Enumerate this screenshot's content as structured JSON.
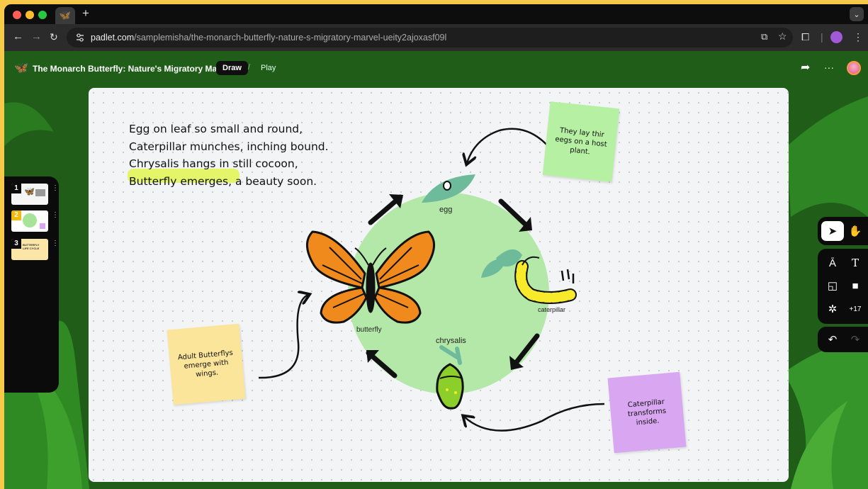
{
  "browser": {
    "url_host": "padlet.com",
    "url_path": "/samplemisha/the-monarch-butterfly-nature-s-migratory-marvel-ueity2ajoxasf09l"
  },
  "app": {
    "title": "The Monarch Butterfly: Nature's Migratory Marvel",
    "mode_draw": "Draw",
    "separator": "/",
    "mode_play": "Play"
  },
  "slides": [
    {
      "num": "1"
    },
    {
      "num": "2"
    },
    {
      "num": "3",
      "thumb_text": "BUTTERFLY LIFE CYCLE"
    }
  ],
  "tools": {
    "more_count": "+17"
  },
  "poem": {
    "line1": "Egg on leaf so small and round,",
    "line2": "Caterpillar munches, inching bound.",
    "line3": "Chrysalis hangs in still cocoon,",
    "line4_highlight": "Butterfly emerges,",
    "line4_rest": " a beauty soon."
  },
  "cycle_labels": {
    "egg": "egg",
    "caterpillar": "caterpillar",
    "chrysalis": "chrysalis",
    "butterfly": "butterfly"
  },
  "notes": {
    "green": "They lay thir eegs on a host plant.",
    "yellow": "Adult Butterflys emerge with wings.",
    "purple": "Caterpillar transforms inside."
  },
  "colors": {
    "canvas": "#f3f4f6",
    "circle": "#b3e8a9",
    "note_green": "#b5f0a3",
    "note_yellow": "#fbe59a",
    "note_purple": "#d9a6f2",
    "highlight": "#e4f56a"
  }
}
